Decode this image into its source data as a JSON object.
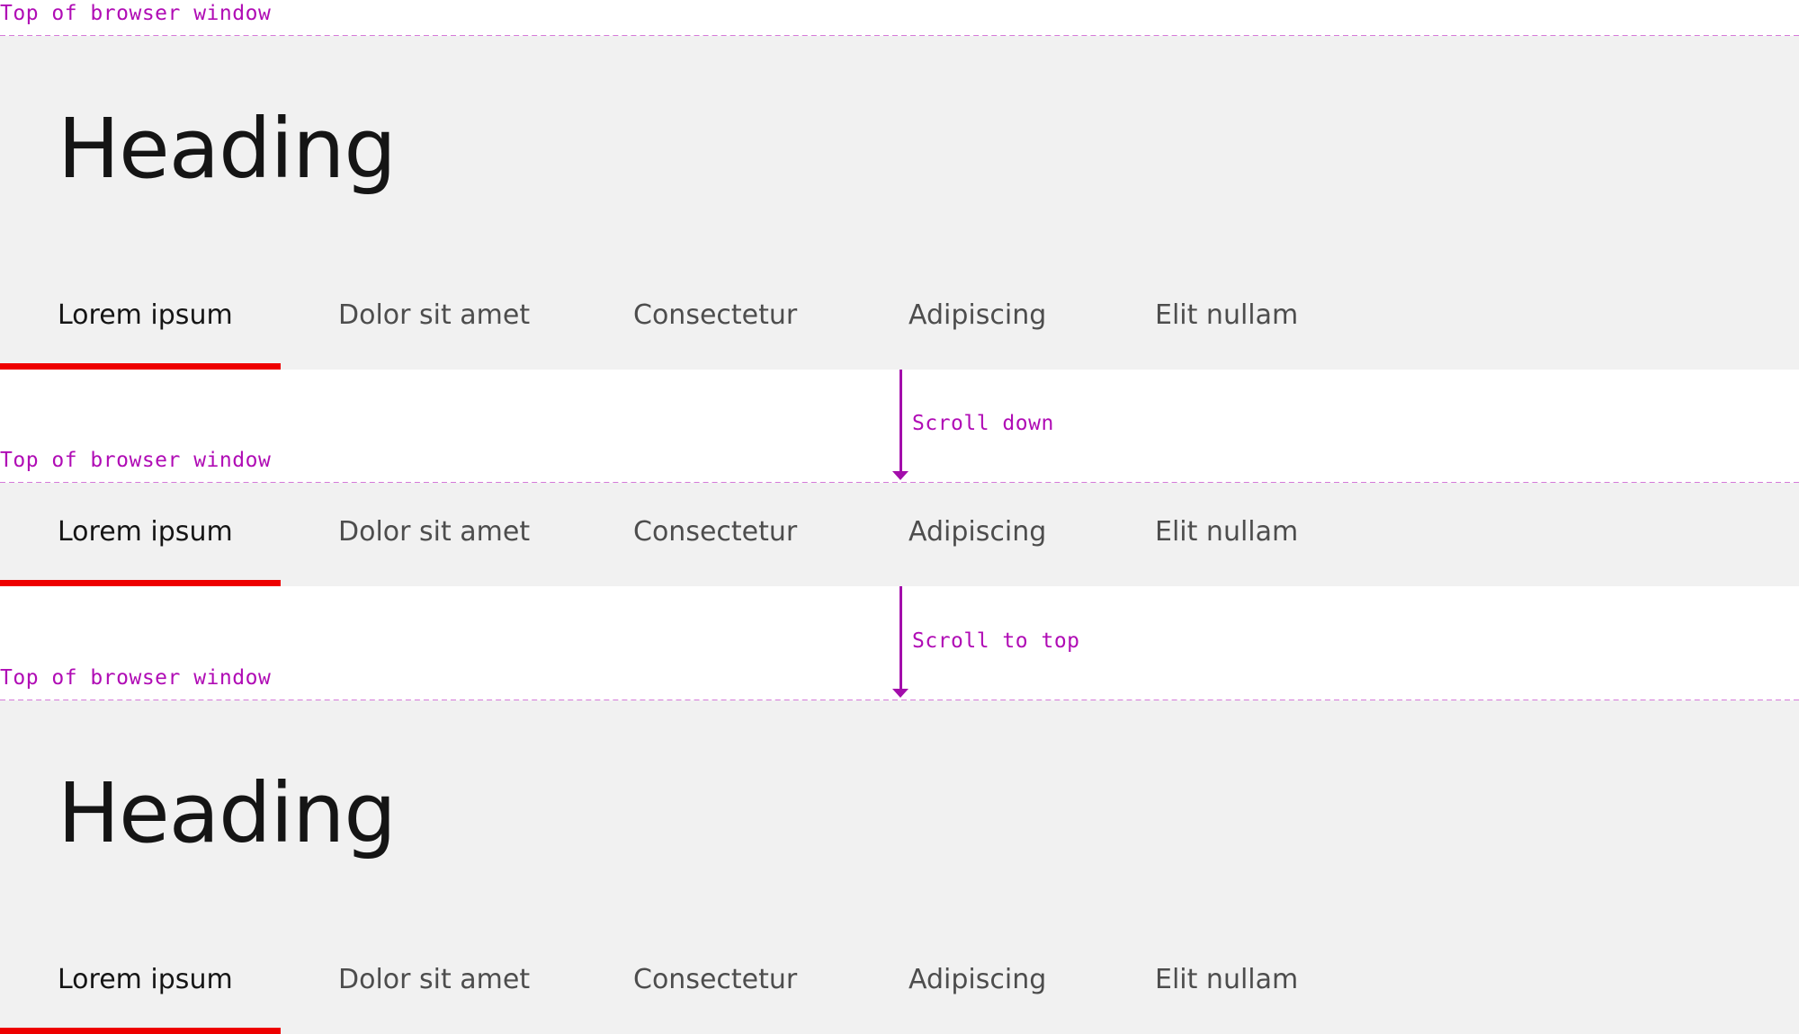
{
  "annotations": {
    "window_top_label": "Top of browser window",
    "scroll_down_label": "Scroll down",
    "scroll_to_top_label": "Scroll to top",
    "annotation_color": "#b00cb5"
  },
  "states": [
    {
      "heading": "Heading",
      "tabs": [
        {
          "label": "Lorem ipsum",
          "active": true
        },
        {
          "label": "Dolor sit amet",
          "active": false
        },
        {
          "label": "Consectetur",
          "active": false
        },
        {
          "label": "Adipiscing",
          "active": false
        },
        {
          "label": "Elit nullam",
          "active": false
        }
      ]
    },
    {
      "tabs": [
        {
          "label": "Lorem ipsum",
          "active": true
        },
        {
          "label": "Dolor sit amet",
          "active": false
        },
        {
          "label": "Consectetur",
          "active": false
        },
        {
          "label": "Adipiscing",
          "active": false
        },
        {
          "label": "Elit nullam",
          "active": false
        }
      ]
    },
    {
      "heading": "Heading",
      "tabs": [
        {
          "label": "Lorem ipsum",
          "active": true
        },
        {
          "label": "Dolor sit amet",
          "active": false
        },
        {
          "label": "Consectetur",
          "active": false
        },
        {
          "label": "Adipiscing",
          "active": false
        },
        {
          "label": "Elit nullam",
          "active": false
        }
      ]
    }
  ],
  "colors": {
    "active_tab_underline": "#ee0000",
    "panel_background": "#f1f1f1",
    "active_tab_text": "#151515",
    "inactive_tab_text": "#4d4d4d"
  }
}
